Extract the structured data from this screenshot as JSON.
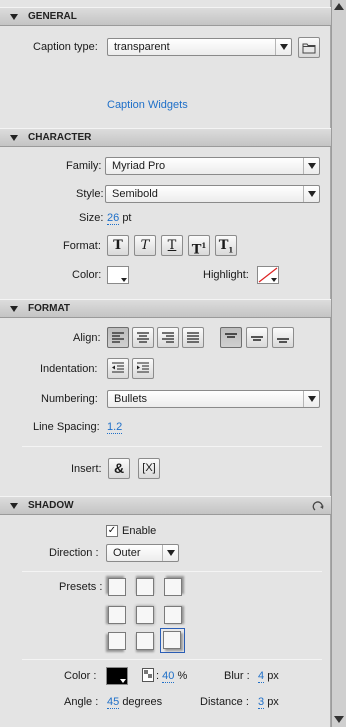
{
  "general": {
    "header": "GENERAL",
    "caption_type_label": "Caption type:",
    "caption_type_value": "transparent",
    "caption_widgets_link": "Caption Widgets"
  },
  "character": {
    "header": "CHARACTER",
    "family_label": "Family:",
    "family_value": "Myriad Pro",
    "style_label": "Style:",
    "style_value": "Semibold",
    "size_label": "Size:",
    "size_value": "26",
    "size_unit": "pt",
    "format_label": "Format:",
    "format_buttons": [
      "T",
      "T",
      "T",
      "T",
      "T"
    ],
    "color_label": "Color:",
    "color_value": "#ffffff",
    "highlight_label": "Highlight:"
  },
  "format": {
    "header": "FORMAT",
    "align_label": "Align:",
    "indentation_label": "Indentation:",
    "numbering_label": "Numbering:",
    "numbering_value": "Bullets",
    "line_spacing_label": "Line Spacing:",
    "line_spacing_value": "1.2",
    "insert_label": "Insert:",
    "insert_symbol": "&",
    "insert_variable": "[X]"
  },
  "shadow": {
    "header": "SHADOW",
    "enable_label": "Enable",
    "enable_checked": true,
    "direction_label": "Direction :",
    "direction_value": "Outer",
    "presets_label": "Presets :",
    "color_label": "Color :",
    "color_value": "#000000",
    "opacity_value": "40",
    "opacity_unit": "%",
    "blur_label": "Blur :",
    "blur_value": "4",
    "blur_unit": "px",
    "angle_label": "Angle :",
    "angle_value": "45",
    "angle_unit": "degrees",
    "distance_label": "Distance :",
    "distance_value": "3",
    "distance_unit": "px"
  },
  "colors": {
    "link": "#1e6fc8",
    "panel_bg": "#e4e4e4",
    "selected_preset_border": "#2b5fb8"
  }
}
